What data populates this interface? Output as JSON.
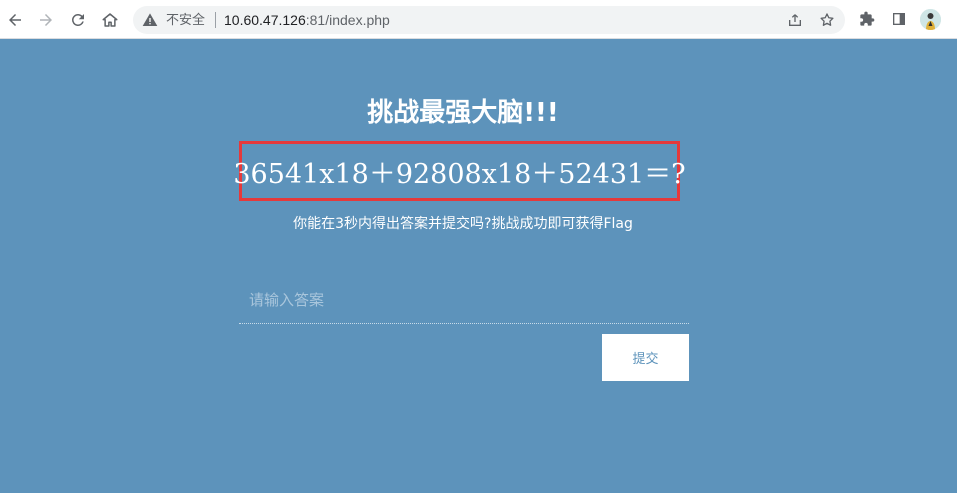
{
  "browser": {
    "security_label": "不安全",
    "url_host": "10.60.47.126",
    "url_rest": ":81/index.php"
  },
  "page": {
    "title": "挑战最强大脑!!!",
    "equation": "36541x18＋92808x18＋52431＝?",
    "hint": "你能在3秒内得出答案并提交吗?挑战成功即可获得Flag",
    "answer_placeholder": "请输入答案",
    "answer_value": "",
    "submit_label": "提交"
  },
  "colors": {
    "page_background": "#5d93bb",
    "highlight_border": "#e5393b",
    "button_background": "#ffffff",
    "button_text": "#5d93bb"
  },
  "icons": {
    "back": "back-arrow-icon",
    "forward": "forward-arrow-icon",
    "reload": "reload-icon",
    "home": "home-icon",
    "warning": "warning-triangle-icon",
    "share": "share-icon",
    "bookmark": "star-icon",
    "extensions": "puzzle-icon",
    "sidepanel": "side-panel-icon",
    "profile": "avatar"
  }
}
